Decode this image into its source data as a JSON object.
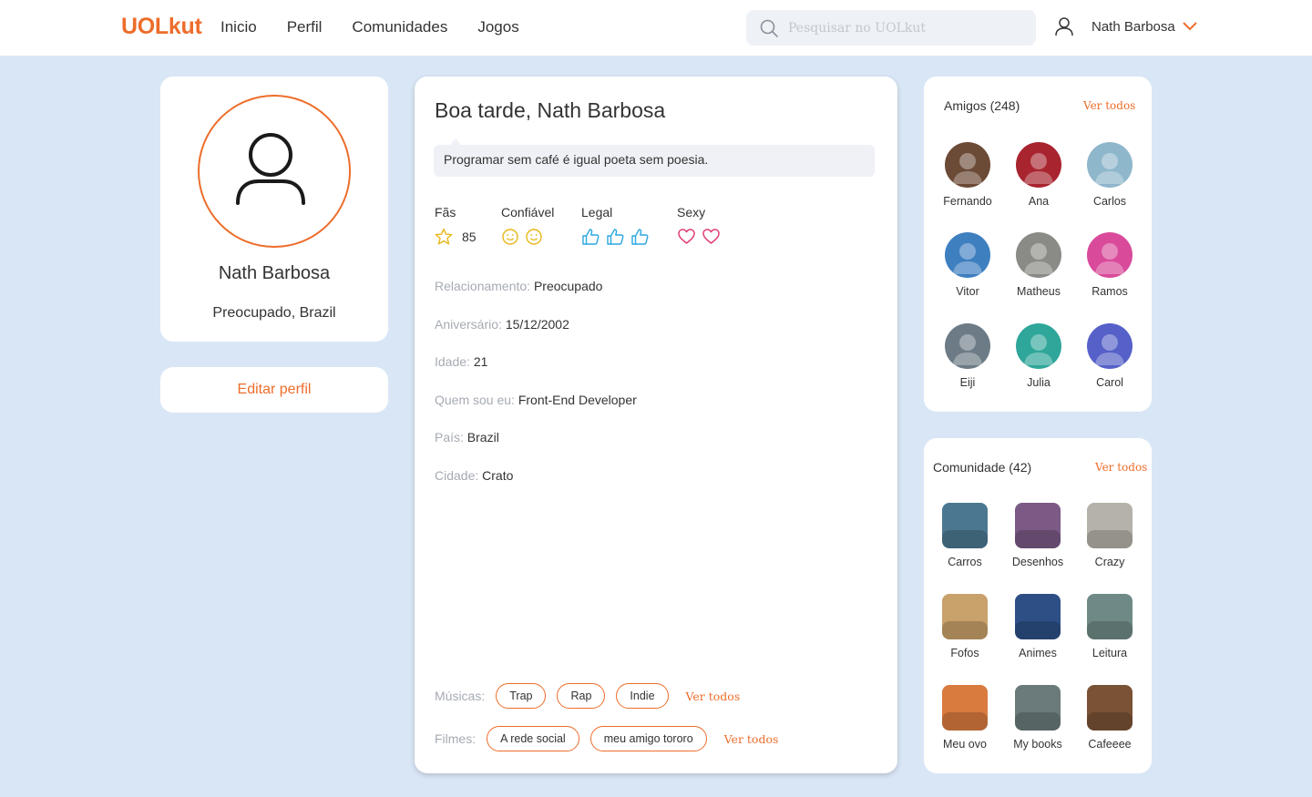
{
  "header": {
    "logo": "UOLkut",
    "nav": [
      "Inicio",
      "Perfil",
      "Comunidades",
      "Jogos"
    ],
    "search_placeholder": "Pesquisar no UOLkut",
    "user_name": "Nath Barbosa"
  },
  "profile": {
    "name": "Nath Barbosa",
    "location": "Preocupado, Brazil",
    "edit_label": "Editar perfil"
  },
  "main": {
    "greeting": "Boa tarde, Nath Barbosa",
    "quote": "Programar sem café é igual poeta sem poesia.",
    "ratings": {
      "fans_label": "Fãs",
      "fans_count": "85",
      "trusty_label": "Confiável",
      "cool_label": "Legal",
      "sexy_label": "Sexy"
    },
    "info": [
      {
        "key": "Relacionamento:",
        "value": "Preocupado"
      },
      {
        "key": "Aniversário:",
        "value": "15/12/2002"
      },
      {
        "key": "Idade:",
        "value": "21"
      },
      {
        "key": "Quem sou eu:",
        "value": "Front-End Developer"
      },
      {
        "key": "País:",
        "value": "Brazil"
      },
      {
        "key": "Cidade:",
        "value": "Crato"
      }
    ],
    "music_label": "Músicas:",
    "music": [
      "Trap",
      "Rap",
      "Indie"
    ],
    "movies_label": "Filmes:",
    "movies": [
      "A rede social",
      "meu amigo tororo"
    ],
    "see_all": "Ver todos"
  },
  "friends": {
    "title": "Amigos (248)",
    "see_all": "Ver todos",
    "items": [
      {
        "name": "Fernando",
        "color": "#6b4a36"
      },
      {
        "name": "Ana",
        "color": "#a8242f"
      },
      {
        "name": "Carlos",
        "color": "#8fb7cc"
      },
      {
        "name": "Vitor",
        "color": "#3e7fc0"
      },
      {
        "name": "Matheus",
        "color": "#8a8a86"
      },
      {
        "name": "Ramos",
        "color": "#d94a9a"
      },
      {
        "name": "Eiji",
        "color": "#6d7b86"
      },
      {
        "name": "Julia",
        "color": "#2fa69a"
      },
      {
        "name": "Carol",
        "color": "#5560c8"
      }
    ]
  },
  "communities": {
    "title": "Comunidade (42)",
    "see_all": "Ver todos",
    "items": [
      {
        "name": "Carros",
        "color": "#4b7890"
      },
      {
        "name": "Desenhos",
        "color": "#7b5a86"
      },
      {
        "name": "Crazy",
        "color": "#b5b2aa"
      },
      {
        "name": "Fofos",
        "color": "#c9a16b"
      },
      {
        "name": "Animes",
        "color": "#2d4f86"
      },
      {
        "name": "Leitura",
        "color": "#6f8a86"
      },
      {
        "name": "Meu ovo",
        "color": "#d97a3e"
      },
      {
        "name": "My books",
        "color": "#6b7a7a"
      },
      {
        "name": "Cafeeee",
        "color": "#7a5236"
      }
    ]
  }
}
